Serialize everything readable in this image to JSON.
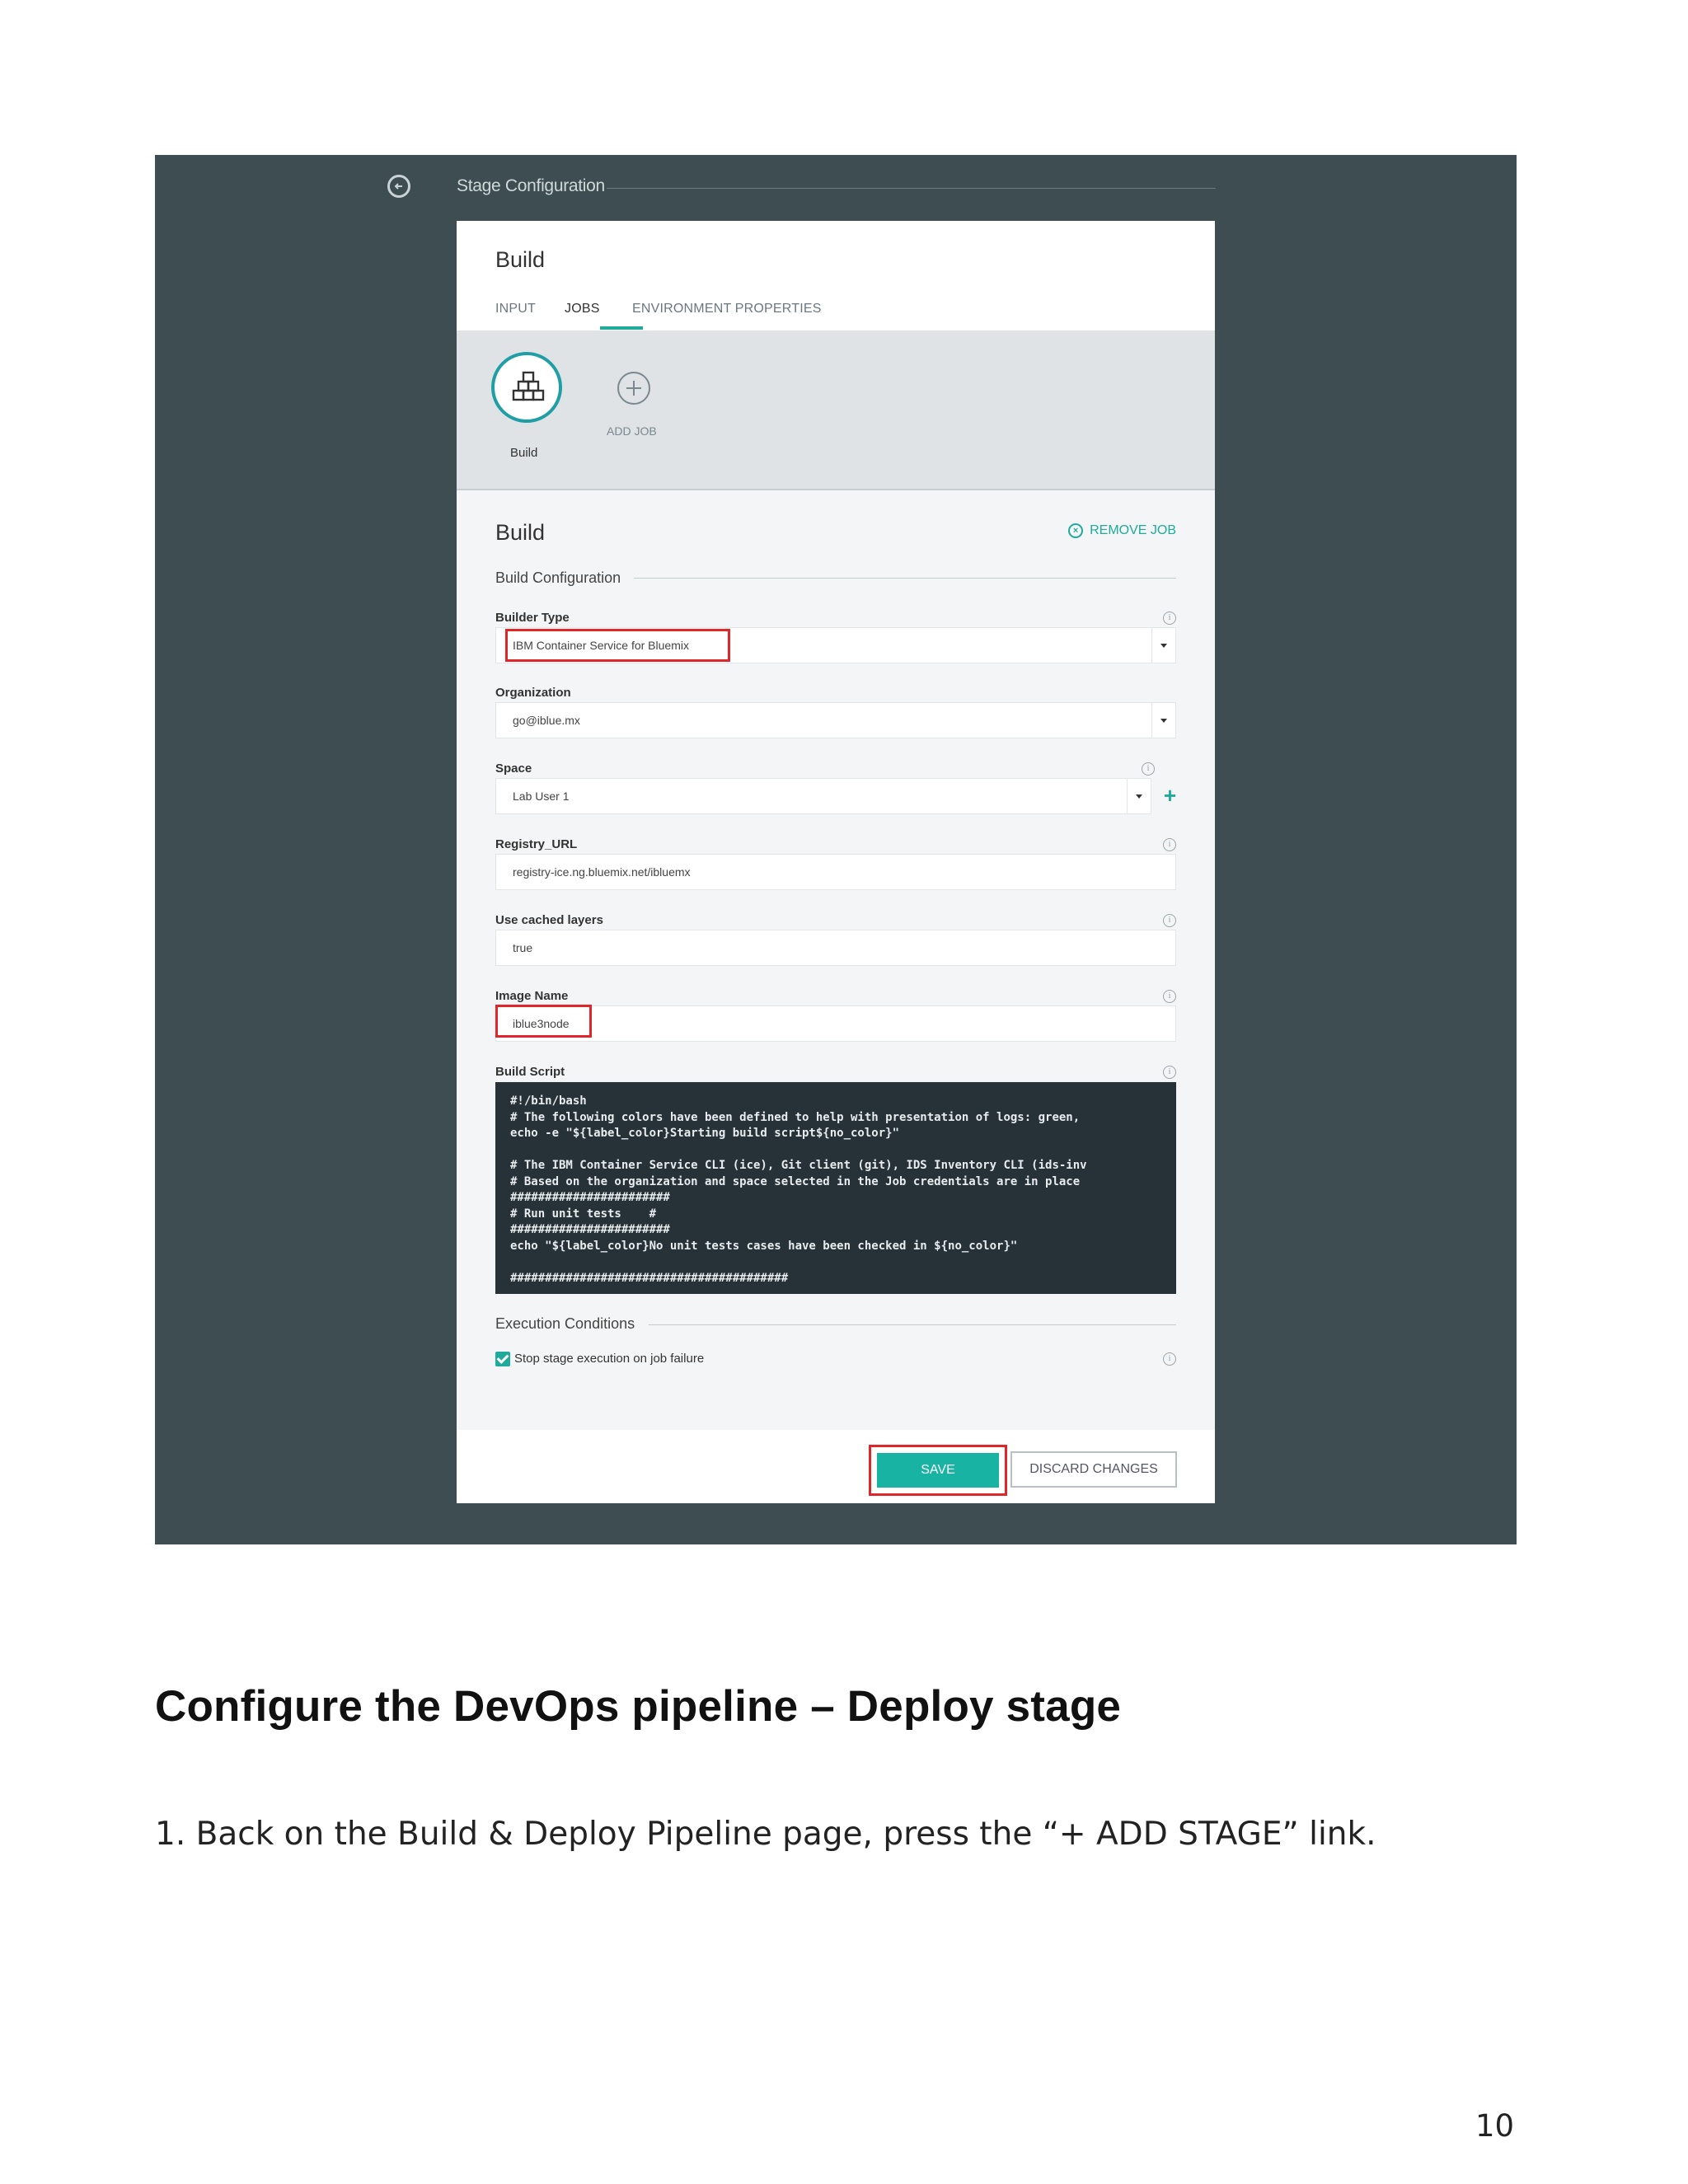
{
  "stage": {
    "title": "Stage Configuration"
  },
  "panel": {
    "title": "Build",
    "tabs": [
      "INPUT",
      "JOBS",
      "ENVIRONMENT PROPERTIES"
    ],
    "active_tab": "JOBS"
  },
  "jobs": {
    "items": [
      {
        "label": "Build",
        "icon": "stacked-boxes-icon",
        "selected": true
      }
    ],
    "add_label": "ADD JOB"
  },
  "job": {
    "title": "Build",
    "remove_label": "REMOVE JOB",
    "build_config_section": "Build Configuration",
    "fields": {
      "builder_type": {
        "label": "Builder Type",
        "value": "IBM Container Service for Bluemix"
      },
      "organization": {
        "label": "Organization",
        "value": "go@iblue.mx"
      },
      "space": {
        "label": "Space",
        "value": "Lab User 1"
      },
      "registry_url": {
        "label": "Registry_URL",
        "value": "registry-ice.ng.bluemix.net/ibluemx"
      },
      "use_cached_layers": {
        "label": "Use cached layers",
        "value": "true"
      },
      "image_name": {
        "label": "Image Name",
        "value": "iblue3node"
      },
      "build_script": {
        "label": "Build Script",
        "value": "#!/bin/bash\n# The following colors have been defined to help with presentation of logs: green,\necho -e \"${label_color}Starting build script${no_color}\"\n\n# The IBM Container Service CLI (ice), Git client (git), IDS Inventory CLI (ids-inv\n# Based on the organization and space selected in the Job credentials are in place\n#######################\n# Run unit tests    #\n#######################\necho \"${label_color}No unit tests cases have been checked in ${no_color}\"\n\n########################################"
      }
    },
    "execution_section": "Execution Conditions",
    "stop_on_failure": {
      "label": "Stop stage execution on job failure",
      "checked": true
    }
  },
  "footer": {
    "save_label": "SAVE",
    "discard_label": "DISCARD CHANGES"
  },
  "colors": {
    "accent": "#1faa9c",
    "highlight": "#e0262b",
    "backdrop": "#3d4d52"
  },
  "document": {
    "heading": "Configure the DevOps pipeline – Deploy stage",
    "step_1": "1. Back on the Build & Deploy Pipeline page, press the “+ ADD STAGE” link.",
    "page_number": "10"
  }
}
